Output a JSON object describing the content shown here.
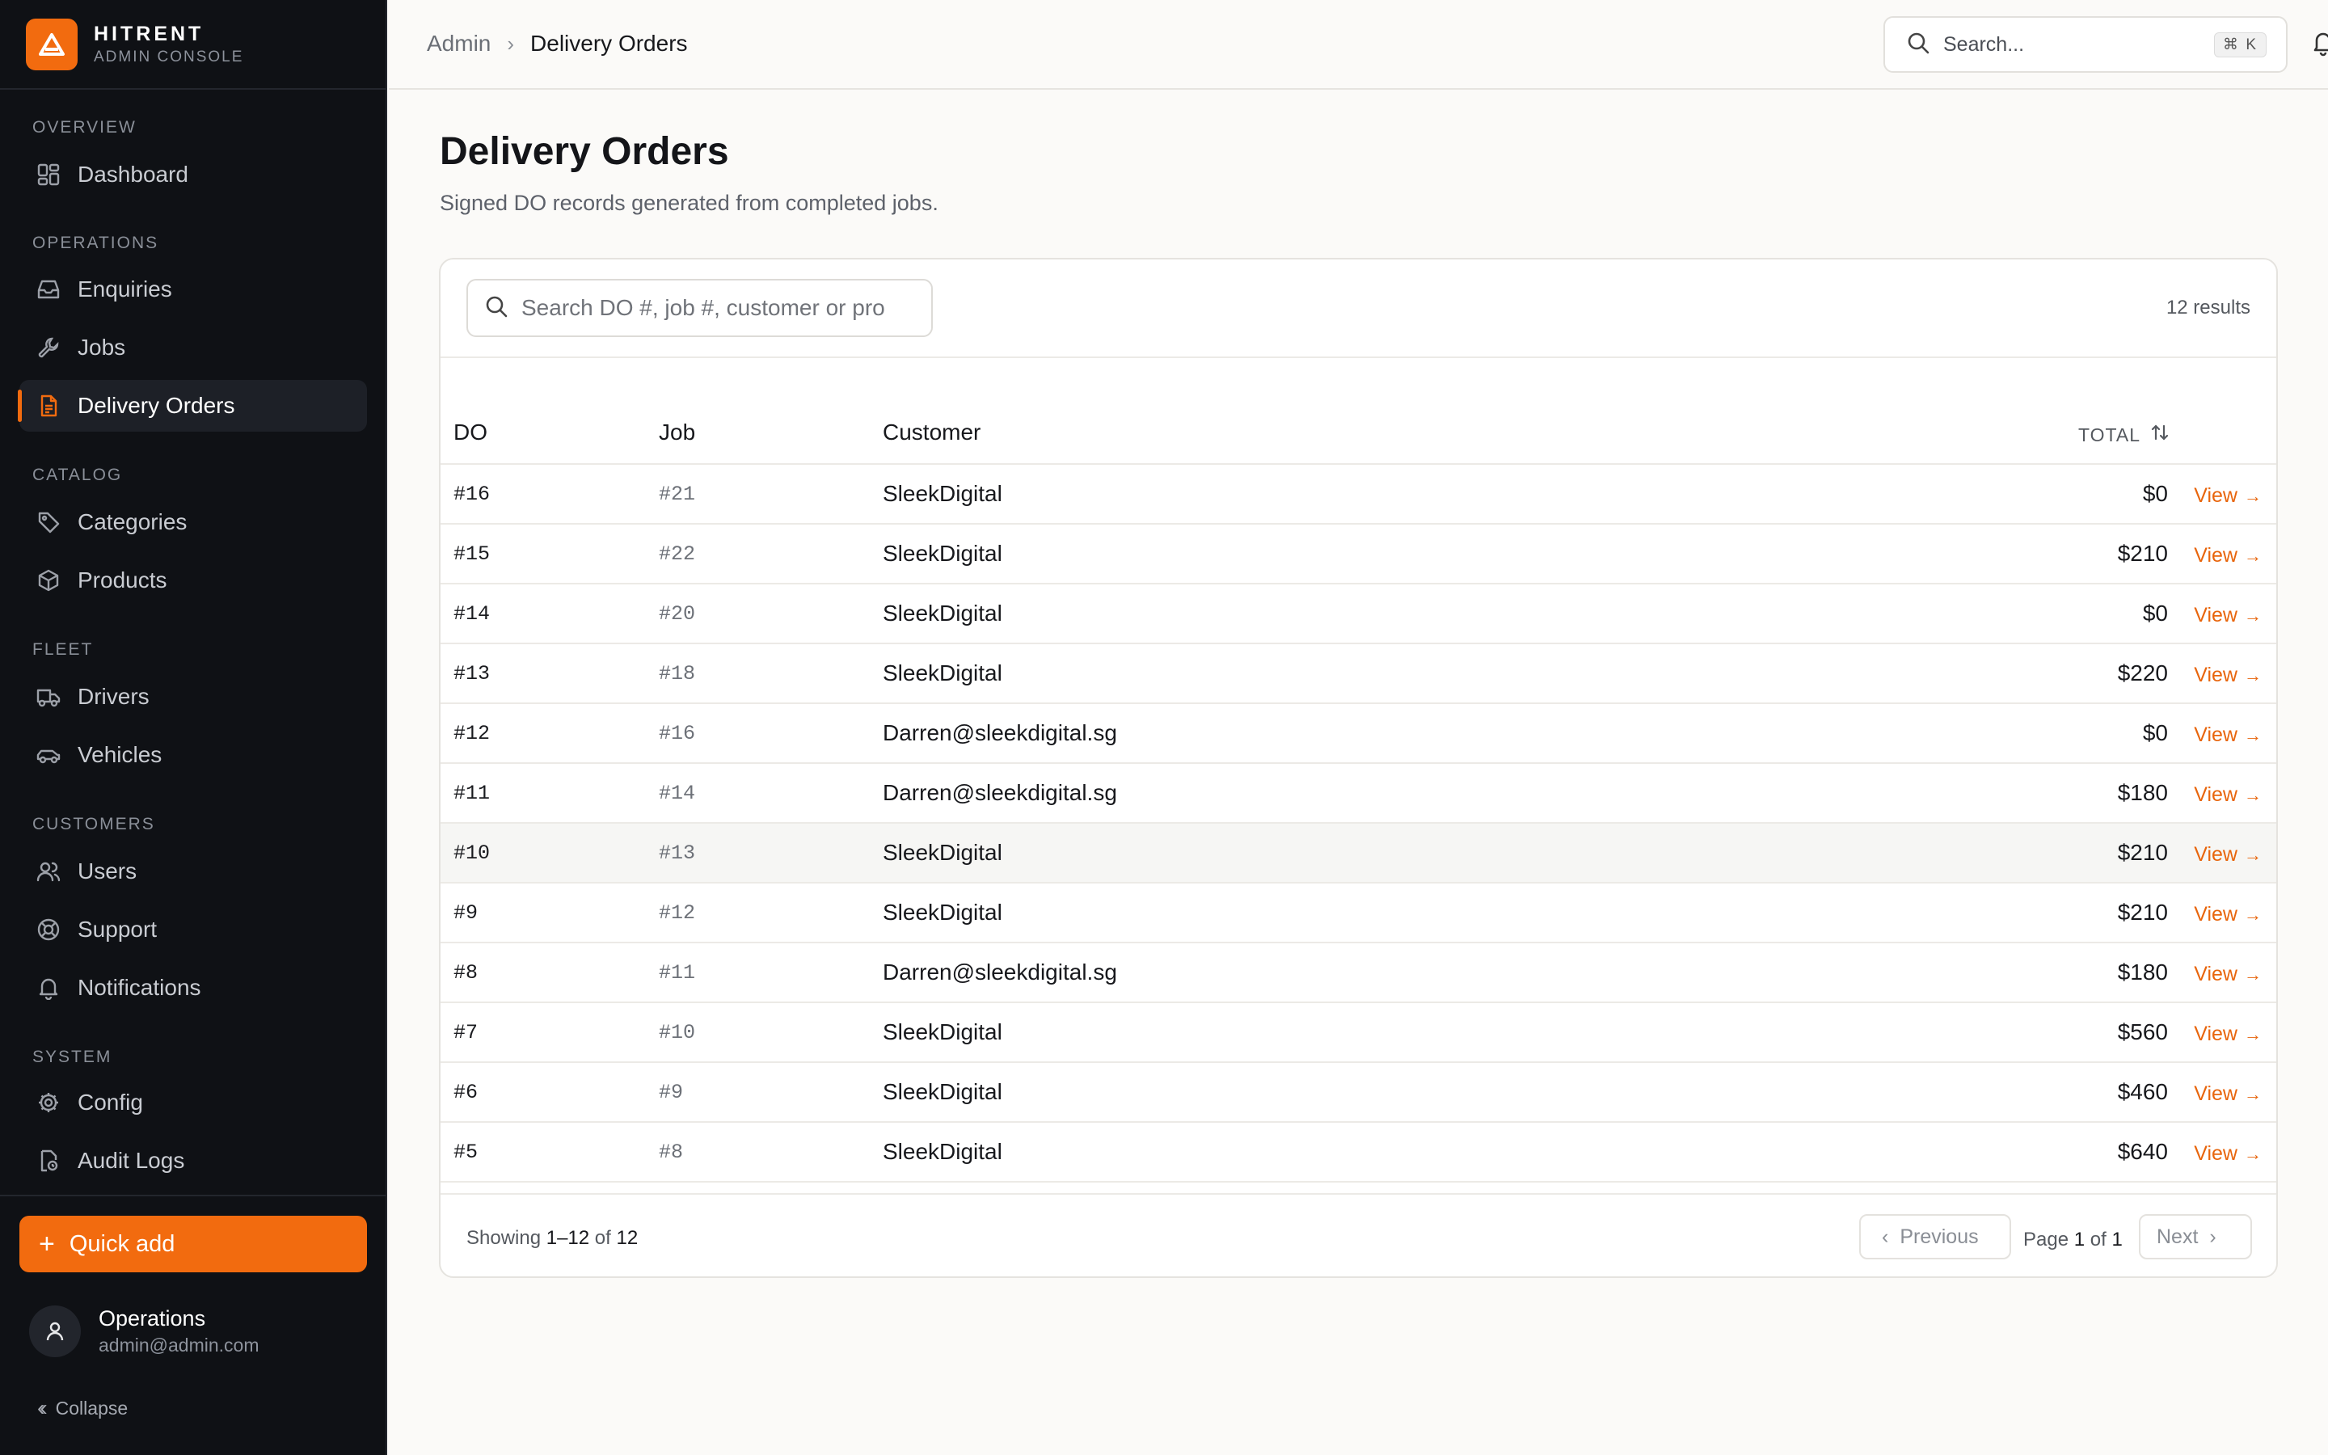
{
  "brand": {
    "name": "HITRENT",
    "subtitle": "ADMIN CONSOLE",
    "accent": "#f26b0f"
  },
  "sidebar": {
    "groups": [
      {
        "title": "OVERVIEW",
        "items": [
          {
            "label": "Dashboard",
            "icon": "dashboard-icon"
          }
        ]
      },
      {
        "title": "OPERATIONS",
        "items": [
          {
            "label": "Enquiries",
            "icon": "inbox-icon"
          },
          {
            "label": "Jobs",
            "icon": "wrench-icon"
          },
          {
            "label": "Delivery Orders",
            "icon": "document-icon",
            "active": true
          }
        ]
      },
      {
        "title": "CATALOG",
        "items": [
          {
            "label": "Categories",
            "icon": "tag-icon"
          },
          {
            "label": "Products",
            "icon": "package-icon"
          }
        ]
      },
      {
        "title": "FLEET",
        "items": [
          {
            "label": "Drivers",
            "icon": "truck-icon"
          },
          {
            "label": "Vehicles",
            "icon": "car-icon"
          }
        ]
      },
      {
        "title": "CUSTOMERS",
        "items": [
          {
            "label": "Users",
            "icon": "users-icon"
          },
          {
            "label": "Support",
            "icon": "lifebuoy-icon"
          },
          {
            "label": "Notifications",
            "icon": "bell-icon"
          }
        ]
      },
      {
        "title": "SYSTEM",
        "items": [
          {
            "label": "Config",
            "icon": "gear-icon"
          },
          {
            "label": "Audit Logs",
            "icon": "audit-icon"
          }
        ]
      }
    ],
    "quick_add": "Quick add",
    "user": {
      "name": "Operations",
      "email": "admin@admin.com"
    },
    "collapse": "Collapse"
  },
  "topbar": {
    "breadcrumb_root": "Admin",
    "breadcrumb_current": "Delivery Orders",
    "search_placeholder": "Search...",
    "shortcut": "⌘ K"
  },
  "page": {
    "title": "Delivery Orders",
    "subtitle": "Signed DO records generated from completed jobs."
  },
  "table": {
    "search_placeholder": "Search DO #, job #, customer or pro",
    "results": "12 results",
    "columns": {
      "do": "DO",
      "job": "Job",
      "customer": "Customer",
      "total": "TOTAL"
    },
    "view_label": "View",
    "rows": [
      {
        "do": "#16",
        "job": "#21",
        "customer": "SleekDigital",
        "total": "$0"
      },
      {
        "do": "#15",
        "job": "#22",
        "customer": "SleekDigital",
        "total": "$210"
      },
      {
        "do": "#14",
        "job": "#20",
        "customer": "SleekDigital",
        "total": "$0"
      },
      {
        "do": "#13",
        "job": "#18",
        "customer": "SleekDigital",
        "total": "$220"
      },
      {
        "do": "#12",
        "job": "#16",
        "customer": "Darren@sleekdigital.sg",
        "total": "$0"
      },
      {
        "do": "#11",
        "job": "#14",
        "customer": "Darren@sleekdigital.sg",
        "total": "$180"
      },
      {
        "do": "#10",
        "job": "#13",
        "customer": "SleekDigital",
        "total": "$210",
        "highlighted": true
      },
      {
        "do": "#9",
        "job": "#12",
        "customer": "SleekDigital",
        "total": "$210"
      },
      {
        "do": "#8",
        "job": "#11",
        "customer": "Darren@sleekdigital.sg",
        "total": "$180"
      },
      {
        "do": "#7",
        "job": "#10",
        "customer": "SleekDigital",
        "total": "$560"
      },
      {
        "do": "#6",
        "job": "#9",
        "customer": "SleekDigital",
        "total": "$460"
      },
      {
        "do": "#5",
        "job": "#8",
        "customer": "SleekDigital",
        "total": "$640"
      }
    ],
    "footer": {
      "showing_prefix": "Showing",
      "showing_range": "1–12",
      "showing_of": "of",
      "showing_total": "12",
      "previous": "Previous",
      "page_prefix": "Page",
      "page_current": "1",
      "page_of": "of",
      "page_total": "1",
      "next": "Next"
    }
  }
}
